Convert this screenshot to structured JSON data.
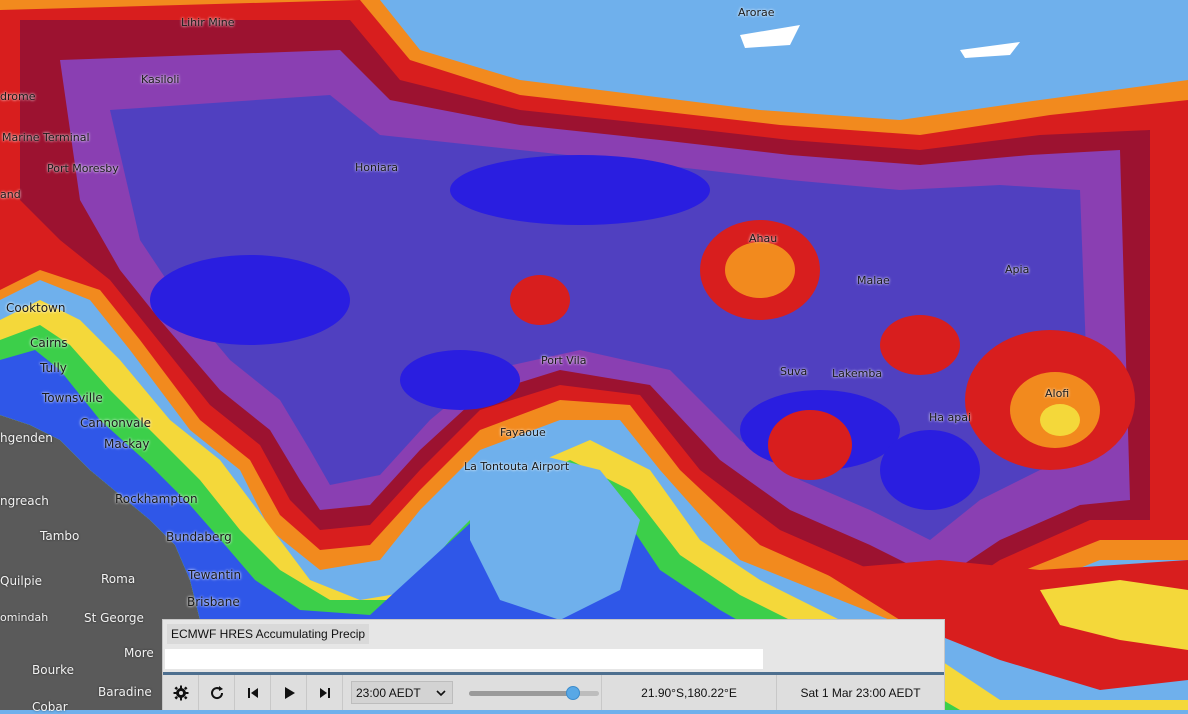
{
  "map": {
    "layer_title": "ECMWF HRES Accumulating Precip",
    "colors": {
      "ocean": "#6fb0ec",
      "land": "#5a5a5a",
      "blue_band": "#2f57e8",
      "green_band": "#3ccf4a",
      "yellow_band": "#f4d83a",
      "orange_band": "#f28a1e",
      "red_band": "#d81e1e",
      "maroon_band": "#9c1230",
      "purple_band": "#8a3fb2",
      "violet_band": "#5040c0",
      "deep_blue_band": "#2a1ee0"
    },
    "places": [
      {
        "name": "Arorae"
      },
      {
        "name": "Lihir Mine"
      },
      {
        "name": "Kasiloli"
      },
      {
        "name": "drome"
      },
      {
        "name": "Marine Terminal"
      },
      {
        "name": "Port Moresby"
      },
      {
        "name": "Honiara"
      },
      {
        "name": "and"
      },
      {
        "name": "Ahau"
      },
      {
        "name": "Malae"
      },
      {
        "name": "Apia"
      },
      {
        "name": "Cooktown"
      },
      {
        "name": "Cairns"
      },
      {
        "name": "Tully"
      },
      {
        "name": "Port Vila"
      },
      {
        "name": "Suva"
      },
      {
        "name": "Lakemba"
      },
      {
        "name": "Townsville"
      },
      {
        "name": "Alofi"
      },
      {
        "name": "Ha apai"
      },
      {
        "name": "Cannonvale"
      },
      {
        "name": "hgenden"
      },
      {
        "name": "Mackay"
      },
      {
        "name": "Fayaoue"
      },
      {
        "name": "La Tontouta Airport"
      },
      {
        "name": "ngreach"
      },
      {
        "name": "Rockhampton"
      },
      {
        "name": "Tambo"
      },
      {
        "name": "Bundaberg"
      },
      {
        "name": "Tewantin"
      },
      {
        "name": "Quilpie"
      },
      {
        "name": "Roma"
      },
      {
        "name": "Brisbane"
      },
      {
        "name": "St George"
      },
      {
        "name": "omindah"
      },
      {
        "name": "Bourke"
      },
      {
        "name": "More"
      },
      {
        "name": "Baradine"
      },
      {
        "name": "Cobar"
      }
    ]
  },
  "controls": {
    "settings_icon": "gear-icon",
    "refresh_icon": "refresh-icon",
    "prev_icon": "skip-back-icon",
    "play_icon": "play-icon",
    "next_icon": "skip-forward-icon",
    "time_select_value": "23:00 AEDT",
    "slider_fraction": 0.8,
    "coordinates": "21.90°S,180.22°E",
    "datetime": "Sat 1 Mar 23:00 AEDT"
  }
}
